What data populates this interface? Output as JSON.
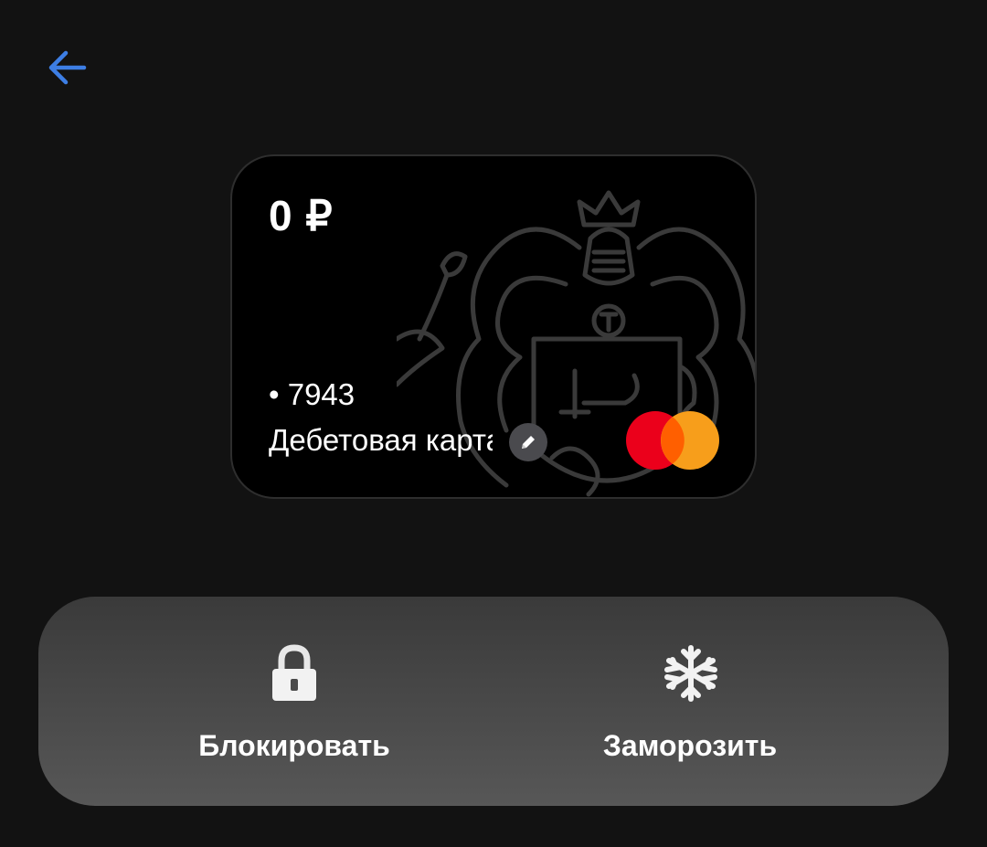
{
  "header": {
    "back_icon": "arrow-left-icon",
    "accent_color": "#3d7ee4"
  },
  "card": {
    "balance": "0 ₽",
    "number": "• 7943",
    "name": "Дебетовая карта",
    "edit_icon": "pencil-icon",
    "payment_system_icon": "mastercard-logo",
    "emblem_icon": "knight-coat-of-arms-icon",
    "colors": {
      "background": "#000000",
      "mc_red": "#eb001b",
      "mc_orange": "#f79e1b"
    }
  },
  "actions": [
    {
      "label": "Блокировать",
      "icon": "lock-icon"
    },
    {
      "label": "Заморозить",
      "icon": "snowflake-icon"
    }
  ]
}
